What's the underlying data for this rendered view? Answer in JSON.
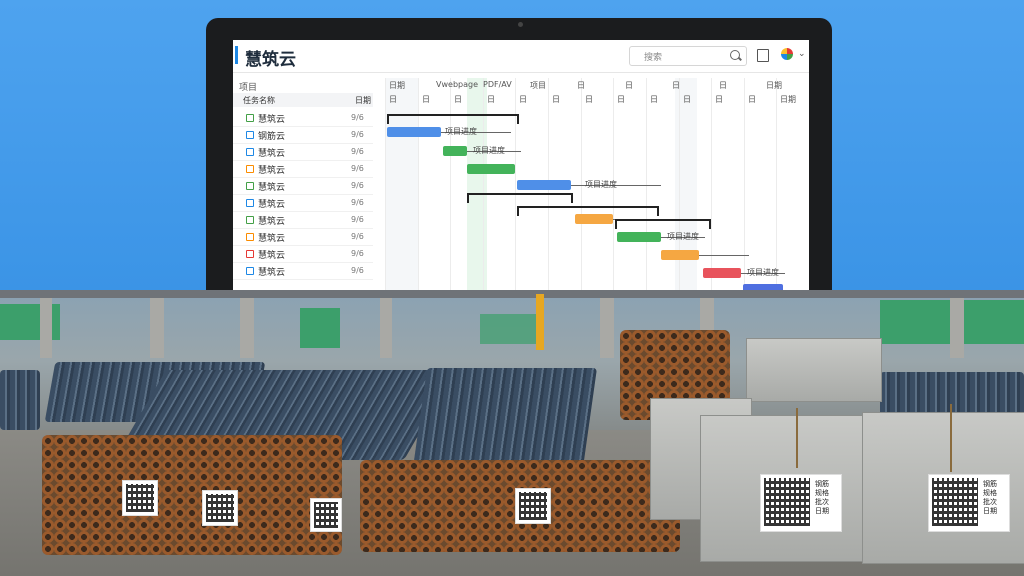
{
  "app": {
    "title": "慧筑云",
    "search_placeholder": "搜索"
  },
  "list": {
    "heading": "项目",
    "col_name": "任务名称",
    "col_date": "日期",
    "rows": [
      {
        "name": "慧筑云",
        "date": "9/6",
        "color": "#43a047"
      },
      {
        "name": "钢筋云",
        "date": "9/6",
        "color": "#1e88e5"
      },
      {
        "name": "慧筑云",
        "date": "9/6",
        "color": "#1e88e5"
      },
      {
        "name": "慧筑云",
        "date": "9/6",
        "color": "#fb8c00"
      },
      {
        "name": "慧筑云",
        "date": "9/6",
        "color": "#43a047"
      },
      {
        "name": "慧筑云",
        "date": "9/6",
        "color": "#1e88e5"
      },
      {
        "name": "慧筑云",
        "date": "9/6",
        "color": "#43a047"
      },
      {
        "name": "慧筑云",
        "date": "9/6",
        "color": "#fb8c00"
      },
      {
        "name": "慧筑云",
        "date": "9/6",
        "color": "#e53935"
      },
      {
        "name": "慧筑云",
        "date": "9/6",
        "color": "#1e88e5"
      }
    ]
  },
  "gantt": {
    "header_top": [
      "日期",
      "Vwebpage",
      "PDF/AV",
      "项目",
      "日",
      "日",
      "日",
      "日",
      "日期"
    ],
    "header_bottom": [
      "日",
      "日",
      "日",
      "日",
      "日",
      "日",
      "日",
      "日",
      "日",
      "日",
      "日",
      "日",
      "日期"
    ],
    "bar_label": "项目进度"
  },
  "qr_tags": [
    {
      "text": "钢筋\n规格\n批次\n日期"
    },
    {
      "text": "钢筋\n规格\n批次\n日期"
    }
  ]
}
